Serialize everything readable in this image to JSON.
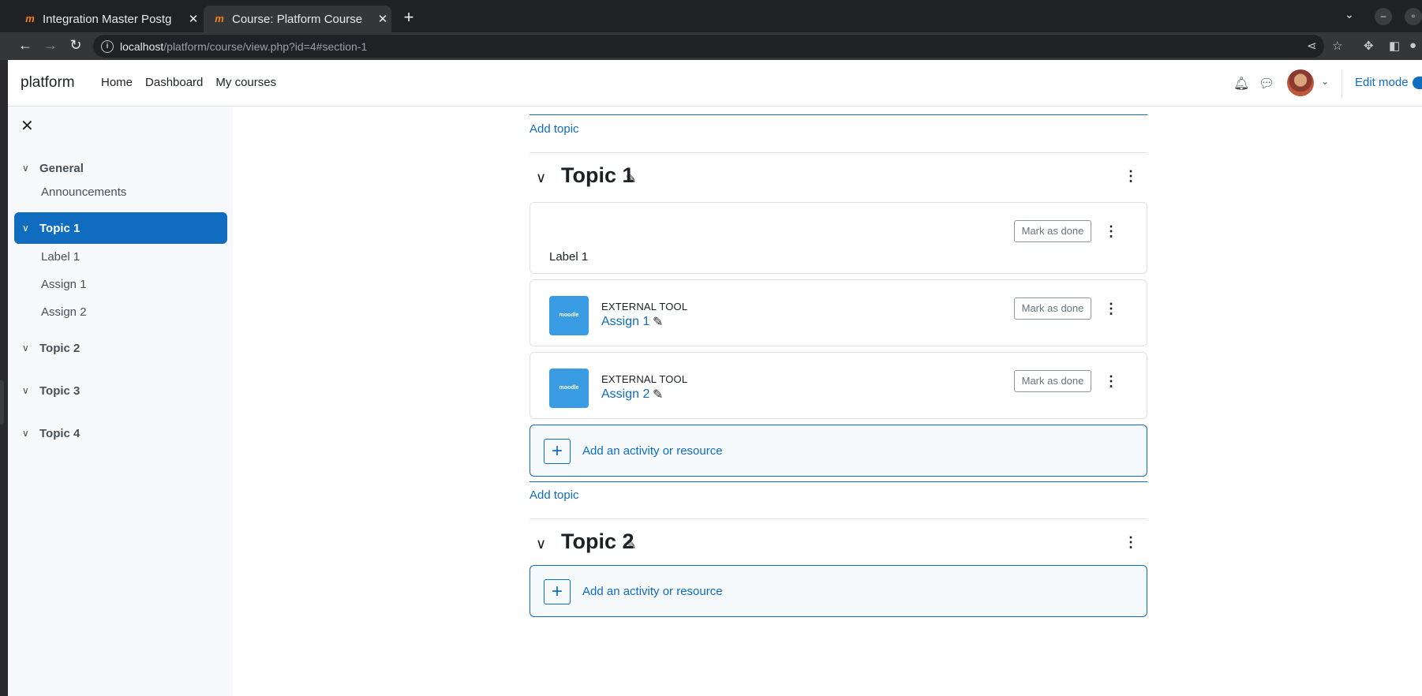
{
  "browser": {
    "tabs": [
      {
        "title": "Integration Master Postg",
        "favicon": "moodle-favicon",
        "active": false
      },
      {
        "title": "Course: Platform Course",
        "favicon": "moodle-favicon",
        "active": true
      }
    ],
    "url_host": "localhost",
    "url_path": "/platform/course/view.php?id=4#section-1"
  },
  "navbar": {
    "brand": "platform",
    "links": [
      "Home",
      "Dashboard",
      "My courses"
    ],
    "edit_mode_label": "Edit mode"
  },
  "course_index": {
    "sections": [
      {
        "label": "General",
        "active": false,
        "activities": [
          "Announcements"
        ]
      },
      {
        "label": "Topic 1",
        "active": true,
        "activities": [
          "Label 1",
          "Assign 1",
          "Assign 2"
        ]
      },
      {
        "label": "Topic 2",
        "active": false,
        "activities": []
      },
      {
        "label": "Topic 3",
        "active": false,
        "activities": []
      },
      {
        "label": "Topic 4",
        "active": false,
        "activities": []
      }
    ]
  },
  "main": {
    "add_topic_label": "Add topic",
    "add_activity_label": "Add an activity or resource",
    "mark_as_done_label": "Mark as done",
    "sections": [
      {
        "title": "Topic 1",
        "activities": [
          {
            "type": "label",
            "text": "Label 1"
          },
          {
            "type_label": "EXTERNAL TOOL",
            "name": "Assign 1",
            "icon_text": "moodle"
          },
          {
            "type_label": "EXTERNAL TOOL",
            "name": "Assign 2",
            "icon_text": "moodle"
          }
        ]
      },
      {
        "title": "Topic 2",
        "activities": []
      }
    ]
  },
  "colors": {
    "primary": "#0f6cbf",
    "tool_icon": "#399be2",
    "moodle_orange": "#f98012"
  }
}
